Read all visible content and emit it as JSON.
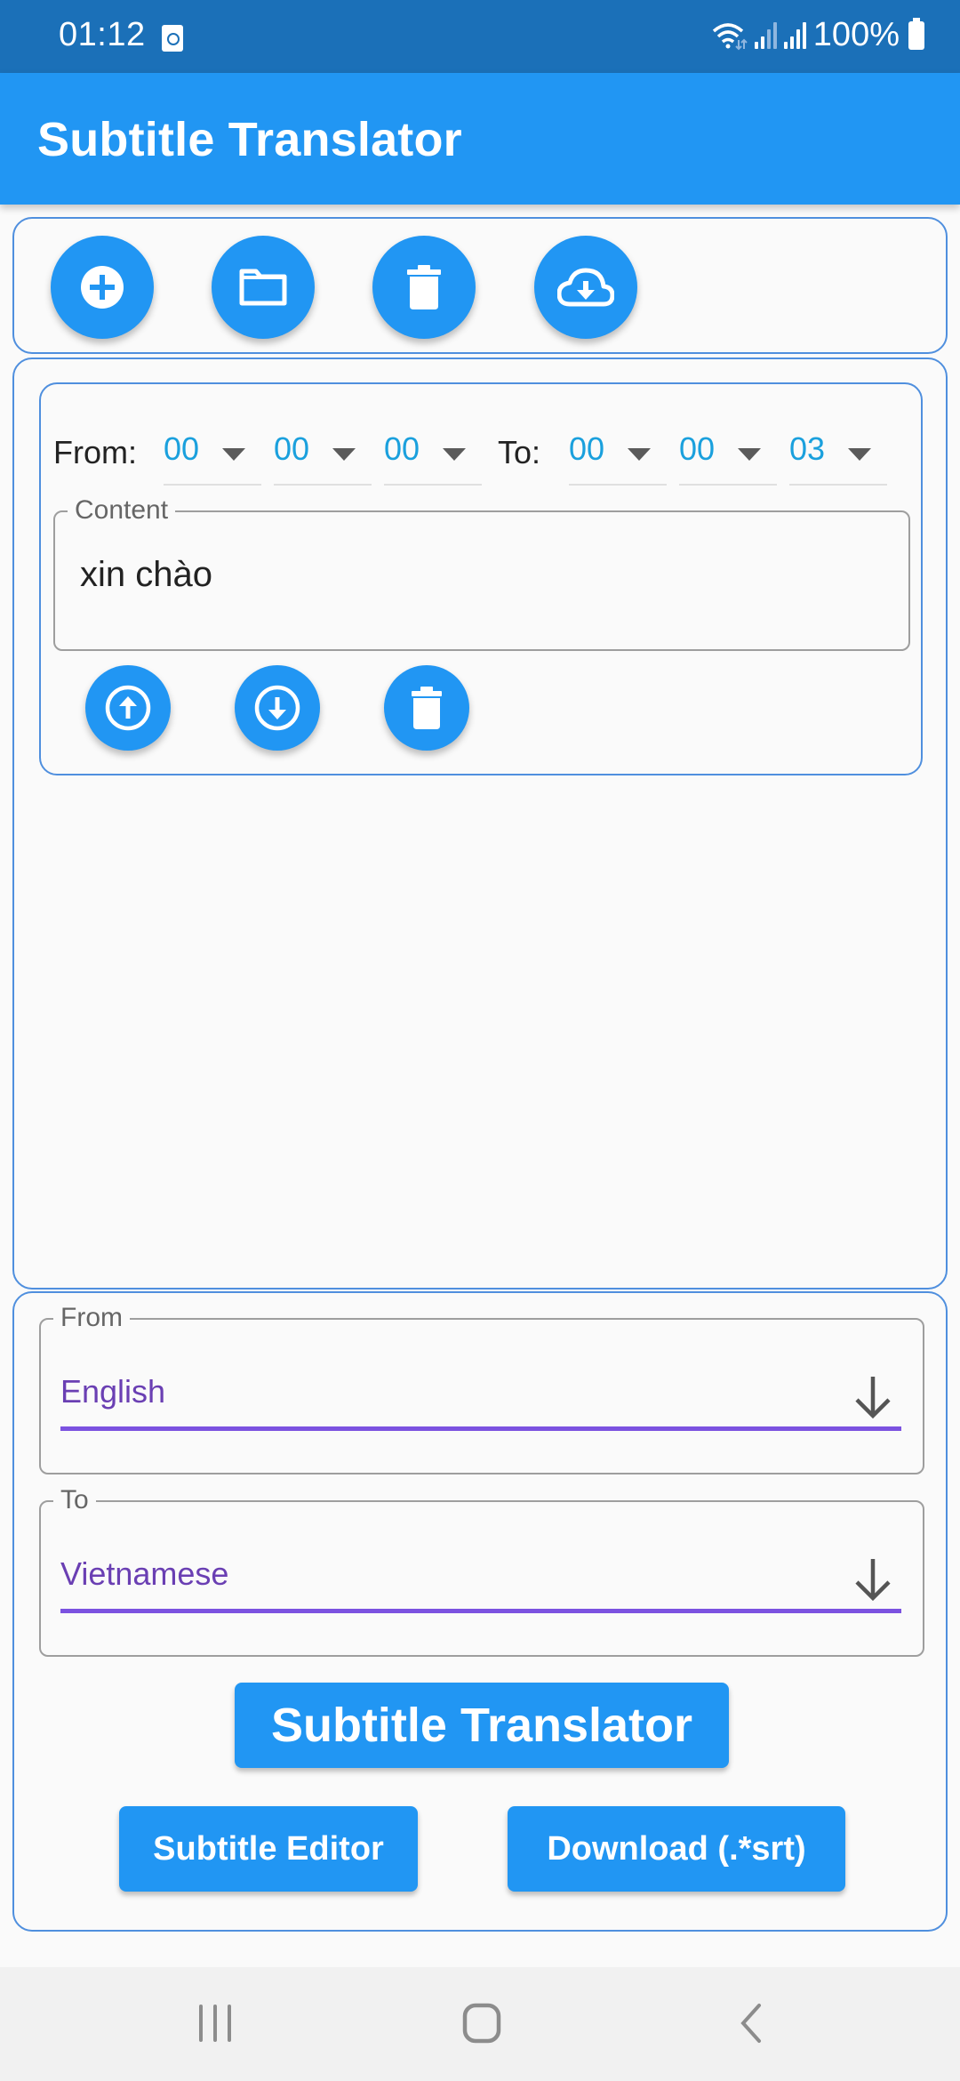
{
  "status_bar": {
    "time": "01:12",
    "battery": "100%"
  },
  "app_bar": {
    "title": "Subtitle Translator"
  },
  "toolbar": {
    "buttons": [
      {
        "name": "add-subtitle-button",
        "icon": "add-circle-icon"
      },
      {
        "name": "open-folder-button",
        "icon": "folder-icon"
      },
      {
        "name": "delete-all-button",
        "icon": "trash-icon"
      },
      {
        "name": "cloud-download-button",
        "icon": "cloud-download-icon"
      }
    ]
  },
  "subtitle_entry": {
    "from_label": "From:",
    "to_label": "To:",
    "from_time": {
      "hours": "00",
      "minutes": "00",
      "seconds": "00"
    },
    "to_time": {
      "hours": "00",
      "minutes": "00",
      "seconds": "03"
    },
    "content_label": "Content",
    "content_value": "xin chào",
    "actions": [
      {
        "name": "move-up-button",
        "icon": "arrow-up-circle-icon"
      },
      {
        "name": "move-down-button",
        "icon": "arrow-down-circle-icon"
      },
      {
        "name": "delete-entry-button",
        "icon": "trash-icon"
      }
    ]
  },
  "translator": {
    "from_label": "From",
    "from_value": "English",
    "to_label": "To",
    "to_value": "Vietnamese",
    "translate_button": "Subtitle Translator",
    "editor_button": "Subtitle Editor",
    "download_button": "Download (.*srt)"
  },
  "colors": {
    "primary": "#2196f3",
    "status_bar": "#1b70b8",
    "panel_border": "#4f8fde",
    "time_value": "#1aa0dd",
    "dropdown_value": "#6a3fb3",
    "dropdown_underline": "#7b52e0"
  }
}
